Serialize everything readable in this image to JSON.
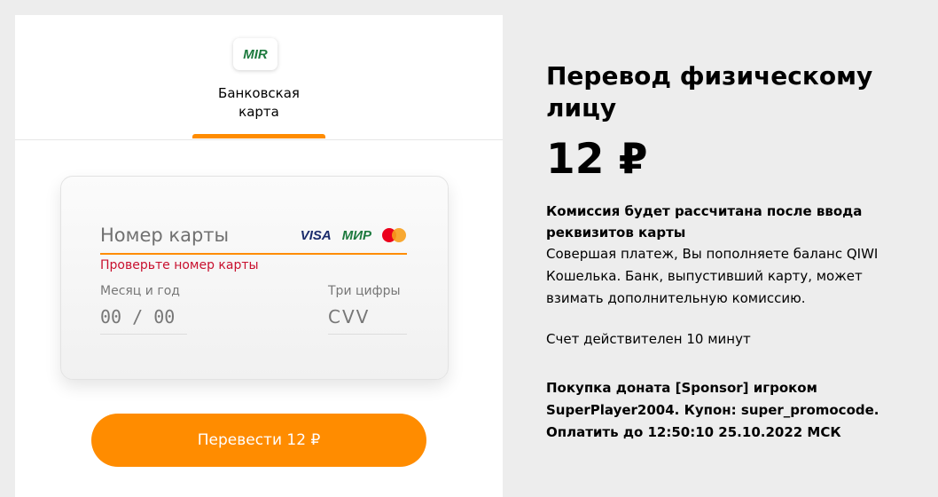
{
  "payment_method": {
    "logo_text": "MIR",
    "label_line1": "Банковская",
    "label_line2": "карта"
  },
  "card_form": {
    "card_number_placeholder": "Номер карты",
    "card_brands": [
      "VISA",
      "МИР",
      "mastercard"
    ],
    "card_number_error": "Проверьте номер карты",
    "expiry_label": "Месяц и год",
    "expiry_value": "00 / 00",
    "cvv_label": "Три цифры",
    "cvv_placeholder": "CVV"
  },
  "submit_button": {
    "label": "Перевести 12 ₽"
  },
  "summary": {
    "title": "Перевод физическому лицу",
    "amount": "12 ₽",
    "commission_title": "Комиссия будет рассчитана после ввода реквизитов карты",
    "commission_text": "Совершая платеж, Вы пополняете баланс QIWI Кошелька. Банк, выпустивший карту, может взимать дополнительную комиссию.",
    "validity": "Счет действителен 10 минут",
    "order_line1": "Покупка доната [Sponsor] игроком",
    "order_line2": "SuperPlayer2004. Купон: super_promocode.",
    "order_line3": "Оплатить до 12:50:10 25.10.2022 МСК"
  },
  "colors": {
    "accent": "#ff8c00",
    "error": "#c8102e",
    "panel_bg": "#ededed"
  }
}
